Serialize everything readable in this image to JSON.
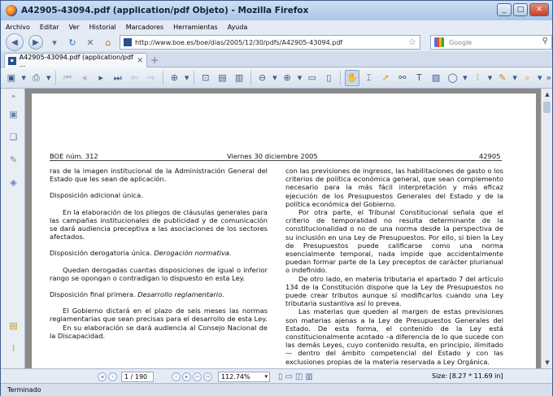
{
  "window": {
    "title": "A42905-43094.pdf (application/pdf Objeto) - Mozilla Firefox",
    "buttons": {
      "minimize": "_",
      "maximize": "□",
      "close": "✕"
    }
  },
  "menubar": {
    "items": [
      "Archivo",
      "Editar",
      "Ver",
      "Historial",
      "Marcadores",
      "Herramientas",
      "Ayuda"
    ]
  },
  "navbar": {
    "url": "http://www.boe.es/boe/dias/2005/12/30/pdfs/A42905-43094.pdf",
    "search_placeholder": "Google"
  },
  "tabs": [
    {
      "label": "A42905-43094.pdf (application/pdf ...",
      "icon": "pdf-icon"
    }
  ],
  "document": {
    "header": {
      "left": "BOE núm. 312",
      "center": "Viernes 30 diciembre 2005",
      "right": "42905"
    },
    "left_column": [
      {
        "text": "ras de la imagen institucional de la Administración General del Estado que les sean de aplicación.",
        "indent": false
      },
      {
        "text": "",
        "gap": true
      },
      {
        "text": "Disposición adicional única.",
        "indent": false
      },
      {
        "text": "",
        "gap": true
      },
      {
        "text": "En la elaboración de los pliegos de cláusulas generales para las campañas institucionales de publicidad y de comunicación se dará audiencia preceptiva a las asociaciones de los sectores afectados.",
        "indent": true
      },
      {
        "text": "",
        "gap": true
      },
      {
        "text": "Disposición derogatoria única.",
        "em": "Derogación normativa."
      },
      {
        "text": "",
        "gap": true
      },
      {
        "text": "Quedan derogadas cuantas disposiciones de igual o inferior rango se opongan o contradigan lo dispuesto en esta Ley.",
        "indent": true
      },
      {
        "text": "",
        "gap": true
      },
      {
        "text": "Disposición final primera.",
        "em": "Desarrollo reglamentario."
      },
      {
        "text": "",
        "gap": true
      },
      {
        "text": "El Gobierno dictará en el plazo de seis meses las normas reglamentarias que sean precisas para el desarrollo de esta Ley.",
        "indent": true
      },
      {
        "text": "En su elaboración se dará audiencia al Consejo Nacional de la Discapacidad.",
        "indent": true
      }
    ],
    "right_column": [
      {
        "text": "con las previsiones de ingresos, las habilitaciones de gasto o los criterios de política económica general, que sean complemento necesario para la más fácil interpretación y más eficaz ejecución de los Presupuestos Generales del Estado y de la política económica del Gobierno.",
        "indent": false
      },
      {
        "text": "Por otra parte, el Tribunal Constitucional señala que el criterio de temporalidad no resulta determinante de la constitucionalidad o no de una norma desde la perspectiva de su inclusión en una Ley de Presupuestos. Por ello, si bien la Ley de Presupuestos puede calificarse como una norma esencialmente temporal, nada impide que accidentalmente puedan formar parte de la Ley preceptos de carácter plurianual o indefinido.",
        "indent": true
      },
      {
        "text": "De otro lado, en materia tributaria el apartado 7 del artículo 134 de la Constitución dispone que la Ley de Presupuestos no puede crear tributos aunque sí modificarlos cuando una Ley tributaria sustantiva así lo prevea.",
        "indent": true
      },
      {
        "text": "Las materias que queden al margen de estas previsiones son materias ajenas a la Ley de Presupuestos Generales del Estado. De esta forma, el contenido de la Ley está constitucionalmente acotado –a diferencia de lo que sucede con las demás Leyes, cuyo contenido resulta, en principio, ilimitado— dentro del ámbito competencial del Estado y con las exclusiones propias de la materia reservada a Ley Orgánica.",
        "indent": true
      }
    ]
  },
  "pdf_bottom": {
    "page_field": "1 / 190",
    "zoom_field": "112.74%",
    "size_text": "Size: [8.27 * 11.69 in]"
  },
  "statusbar": {
    "text": "Terminado"
  }
}
